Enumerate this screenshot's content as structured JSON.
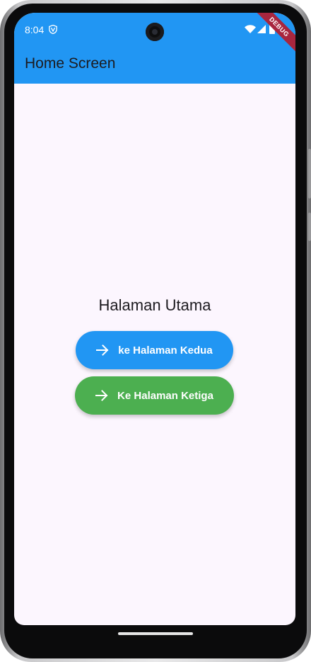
{
  "status_bar": {
    "time": "8:04",
    "debug_label": "DEBUG"
  },
  "app_bar": {
    "title": "Home Screen"
  },
  "main": {
    "title": "Halaman Utama",
    "buttons": [
      {
        "label": "ke Halaman Kedua",
        "icon": "arrow-forward-icon",
        "color": "#2196F3"
      },
      {
        "label": "Ke Halaman Ketiga",
        "icon": "arrow-forward-icon",
        "color": "#4CAF50"
      }
    ]
  },
  "colors": {
    "app_bar": "#2196F3",
    "background": "#FCF6FE"
  }
}
